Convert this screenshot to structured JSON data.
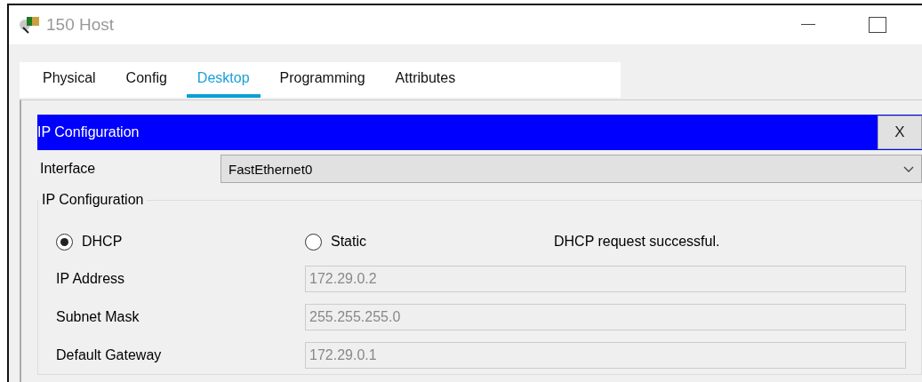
{
  "window": {
    "title": "150 Host"
  },
  "tabs": [
    {
      "label": "Physical",
      "selected": false
    },
    {
      "label": "Config",
      "selected": false
    },
    {
      "label": "Desktop",
      "selected": true
    },
    {
      "label": "Programming",
      "selected": false
    },
    {
      "label": "Attributes",
      "selected": false
    }
  ],
  "panel": {
    "title": "IP Configuration",
    "close": "X"
  },
  "interface": {
    "label": "Interface",
    "value": "FastEthernet0"
  },
  "group": {
    "legend": "IP Configuration",
    "modes": [
      {
        "label": "DHCP",
        "selected": true
      },
      {
        "label": "Static",
        "selected": false
      }
    ],
    "status": "DHCP request successful.",
    "fields": [
      {
        "label": "IP Address",
        "value": "172.29.0.2",
        "disabled": true
      },
      {
        "label": "Subnet Mask",
        "value": "255.255.255.0",
        "disabled": true
      },
      {
        "label": "Default Gateway",
        "value": "172.29.0.1",
        "disabled": true
      }
    ]
  }
}
